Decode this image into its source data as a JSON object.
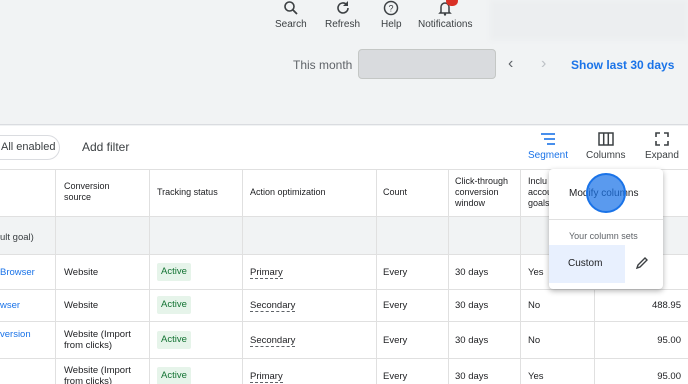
{
  "header": {
    "actions": [
      {
        "label": "Search",
        "icon": "search-icon"
      },
      {
        "label": "Refresh",
        "icon": "refresh-icon"
      },
      {
        "label": "Help",
        "icon": "help-icon"
      },
      {
        "label": "Notifications",
        "icon": "bell-icon"
      }
    ],
    "date_label": "This month",
    "show_last": "Show last 30 days"
  },
  "toolbar": {
    "filter_chip": "All enabled",
    "add_filter": "Add filter",
    "segment": "Segment",
    "columns": "Columns",
    "expand": "Expand"
  },
  "table": {
    "headers": {
      "conversion_source": "Conversion source",
      "tracking_status": "Tracking status",
      "action_optimization": "Action optimization",
      "count": "Count",
      "ctr_window": "Click-through conversion window",
      "incl": "Inclu accou goals"
    },
    "group_label": "ult goal)",
    "rows": [
      {
        "name": "Browser",
        "source": "Website",
        "status": "Active",
        "optimization": "Primary",
        "count": "Every",
        "window": "30 days",
        "incl": "Yes",
        "value": ""
      },
      {
        "name": "wser",
        "source": "Website",
        "status": "Active",
        "optimization": "Secondary",
        "count": "Every",
        "window": "30 days",
        "incl": "No",
        "value": "488.95"
      },
      {
        "name": "version",
        "source": "Website (Import from clicks)",
        "status": "Active",
        "optimization": "Secondary",
        "count": "Every",
        "window": "30 days",
        "incl": "No",
        "value": "95.00"
      },
      {
        "name": "",
        "source": "Website (Import from clicks)",
        "status": "Active",
        "optimization": "Primary",
        "count": "Every",
        "window": "30 days",
        "incl": "Yes",
        "value": "95.00"
      }
    ]
  },
  "menu": {
    "modify_columns": "Modify columns",
    "your_sets": "Your column sets",
    "custom": "Custom"
  },
  "colors": {
    "accent": "#1a73e8",
    "active_bg": "#e6f4ea",
    "active_text": "#137333"
  }
}
